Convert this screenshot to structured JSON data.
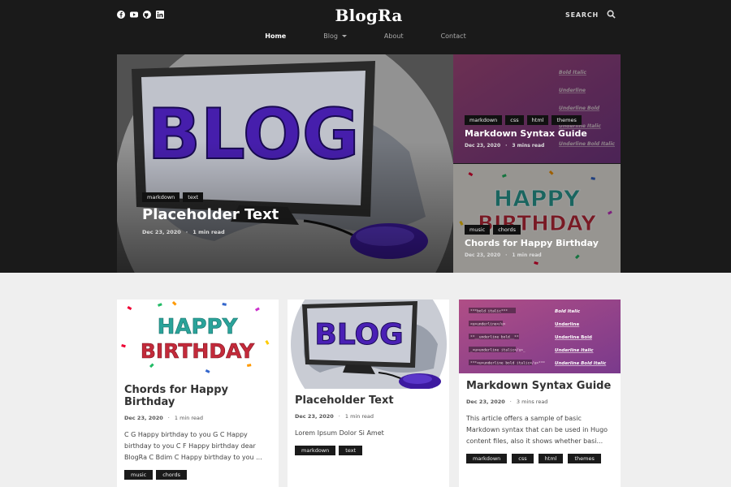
{
  "header": {
    "logo": "BlogRa",
    "search_label": "SEARCH",
    "social": [
      "facebook-icon",
      "youtube-icon",
      "github-icon",
      "linkedin-icon"
    ],
    "nav": [
      {
        "label": "Home",
        "active": true
      },
      {
        "label": "Blog",
        "dropdown": true
      },
      {
        "label": "About"
      },
      {
        "label": "Contact"
      }
    ]
  },
  "hero": {
    "main": {
      "title": "Placeholder Text",
      "tags": [
        "markdown",
        "text"
      ],
      "date": "Dec 23, 2020",
      "read": "1 min read"
    },
    "side1": {
      "title": "Markdown Syntax Guide",
      "tags": [
        "markdown",
        "css",
        "html",
        "themes"
      ],
      "date": "Dec 23, 2020",
      "read": "3 mins read"
    },
    "side2": {
      "title": "Chords for Happy Birthday",
      "tags": [
        "music",
        "chords"
      ],
      "date": "Dec 23, 2020",
      "read": "1 min read"
    }
  },
  "thumbs": {
    "blog_word": "BLOG",
    "happy": "HAPPY",
    "birthday": "BIRTHDAY",
    "md_left": [
      "***bold italic***",
      "<u>underline</u>",
      "**__underline bold__**",
      "_<u>underline italic</u>_",
      "***<u>underline bold italic</u>***"
    ],
    "md_right": [
      "Bold Italic",
      "Underline",
      "Underline Bold",
      "Underline Italic",
      "Underline Bold Italic"
    ]
  },
  "posts": [
    {
      "title": "Chords for Happy Birthday",
      "date": "Dec 23, 2020",
      "read": "1 min read",
      "excerpt": "C G Happy birthday to you G C Happy birthday to you C F Happy birthday dear BlogRa C Bdim C Happy birthday to you ...",
      "tags": [
        "music",
        "chords"
      ]
    },
    {
      "title": "Placeholder Text",
      "date": "Dec 23, 2020",
      "read": "1 min read",
      "excerpt": "Lorem Ipsum Dolor Si Amet",
      "tags": [
        "markdown",
        "text"
      ]
    },
    {
      "title": "Markdown Syntax Guide",
      "date": "Dec 23, 2020",
      "read": "3 mins read",
      "excerpt": "This article offers a sample of basic Markdown syntax that can be used in Hugo content files, also it shows whether basi...",
      "tags": [
        "markdown",
        "css",
        "html",
        "themes"
      ]
    }
  ],
  "colors": {
    "dark": "#1a1a1a",
    "purple": "#5a26c9",
    "magenta": "#a0427f",
    "page_bg": "#efefef"
  }
}
